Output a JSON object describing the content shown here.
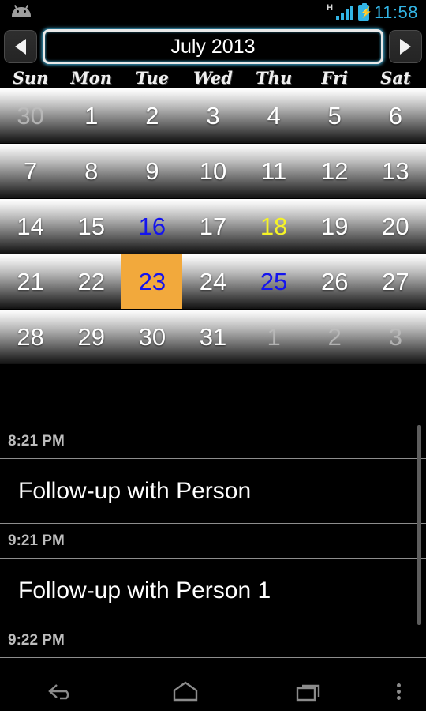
{
  "status_bar": {
    "notification_icon": "android-robot-icon",
    "network_type": "H",
    "signal_icon": "signal-bars-icon",
    "battery_icon": "battery-charging-icon",
    "time": "11:58",
    "accent_color": "#33b5e5"
  },
  "title_bar": {
    "prev_label": "◀",
    "next_label": "▶",
    "month": "July 2013"
  },
  "calendar": {
    "weekdays": [
      "Sun",
      "Mon",
      "Tue",
      "Wed",
      "Thu",
      "Fri",
      "Sat"
    ],
    "selected_color": "#f2a93c",
    "blue_color": "#1414ee",
    "yellow_color": "#f5f326",
    "weeks": [
      [
        {
          "day": "30",
          "style": "dim"
        },
        {
          "day": "1",
          "style": "normal"
        },
        {
          "day": "2",
          "style": "normal"
        },
        {
          "day": "3",
          "style": "normal"
        },
        {
          "day": "4",
          "style": "normal"
        },
        {
          "day": "5",
          "style": "normal"
        },
        {
          "day": "6",
          "style": "normal"
        }
      ],
      [
        {
          "day": "7",
          "style": "normal"
        },
        {
          "day": "8",
          "style": "normal"
        },
        {
          "day": "9",
          "style": "normal"
        },
        {
          "day": "10",
          "style": "normal"
        },
        {
          "day": "11",
          "style": "normal"
        },
        {
          "day": "12",
          "style": "normal"
        },
        {
          "day": "13",
          "style": "normal"
        }
      ],
      [
        {
          "day": "14",
          "style": "normal"
        },
        {
          "day": "15",
          "style": "normal"
        },
        {
          "day": "16",
          "style": "blue"
        },
        {
          "day": "17",
          "style": "normal"
        },
        {
          "day": "18",
          "style": "yellow"
        },
        {
          "day": "19",
          "style": "normal"
        },
        {
          "day": "20",
          "style": "normal"
        }
      ],
      [
        {
          "day": "21",
          "style": "normal"
        },
        {
          "day": "22",
          "style": "normal"
        },
        {
          "day": "23",
          "style": "sel"
        },
        {
          "day": "24",
          "style": "normal"
        },
        {
          "day": "25",
          "style": "blue"
        },
        {
          "day": "26",
          "style": "normal"
        },
        {
          "day": "27",
          "style": "normal"
        }
      ],
      [
        {
          "day": "28",
          "style": "normal"
        },
        {
          "day": "29",
          "style": "normal"
        },
        {
          "day": "30",
          "style": "normal"
        },
        {
          "day": "31",
          "style": "normal"
        },
        {
          "day": "1",
          "style": "dim"
        },
        {
          "day": "2",
          "style": "dim"
        },
        {
          "day": "3",
          "style": "dim"
        }
      ]
    ]
  },
  "events": [
    {
      "type": "time",
      "text": "8:21 PM"
    },
    {
      "type": "event",
      "text": "Follow-up with Person"
    },
    {
      "type": "time",
      "text": "9:21 PM"
    },
    {
      "type": "event",
      "text": "Follow-up with Person 1"
    },
    {
      "type": "time",
      "text": "9:22 PM"
    }
  ],
  "nav_bar": {
    "back": "back-icon",
    "home": "home-icon",
    "recents": "recents-icon",
    "menu": "overflow-menu-icon"
  }
}
